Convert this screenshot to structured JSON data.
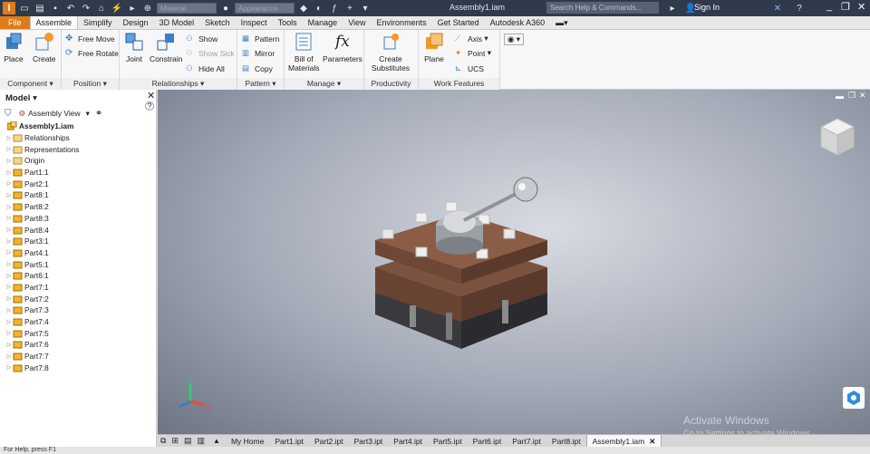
{
  "titlebar": {
    "app_logo": "I",
    "style_dropdown": "Material",
    "appearance_dropdown": "Appearance",
    "document_title": "Assembly1.iam",
    "search_placeholder": "Search Help & Commands...",
    "sign_in": "Sign In"
  },
  "menu": {
    "tabs": [
      "File",
      "Assemble",
      "Simplify",
      "Design",
      "3D Model",
      "Sketch",
      "Inspect",
      "Tools",
      "Manage",
      "View",
      "Environments",
      "Get Started",
      "Autodesk A360"
    ],
    "active": "Assemble"
  },
  "ribbon": {
    "component": {
      "title": "Component",
      "place": "Place",
      "create": "Create"
    },
    "position": {
      "title": "Position",
      "free_move": "Free Move",
      "free_rotate": "Free Rotate"
    },
    "relationships": {
      "title": "Relationships",
      "joint": "Joint",
      "constrain": "Constrain",
      "show": "Show",
      "show_sick": "Show Sick",
      "hide_all": "Hide All"
    },
    "pattern": {
      "title": "Pattern",
      "pattern": "Pattern",
      "mirror": "Mirror",
      "copy": "Copy"
    },
    "manage": {
      "title": "Manage",
      "bill_line1": "Bill of",
      "bill_line2": "Materials",
      "parameters": "Parameters"
    },
    "productivity": {
      "title": "Productivity",
      "create_line1": "Create",
      "create_line2": "Substitutes"
    },
    "work_features": {
      "title": "Work Features",
      "plane": "Plane",
      "axis": "Axis",
      "point": "Point",
      "ucs": "UCS"
    }
  },
  "browser": {
    "title": "Model",
    "view_mode": "Assembly View",
    "root": "Assembly1.iam",
    "items": [
      "Relationships",
      "Representations",
      "Origin",
      "Part1:1",
      "Part2:1",
      "Part8:1",
      "Part8:2",
      "Part8:3",
      "Part8:4",
      "Part3:1",
      "Part4:1",
      "Part5:1",
      "Part6:1",
      "Part7:1",
      "Part7:2",
      "Part7:3",
      "Part7:4",
      "Part7:5",
      "Part7:6",
      "Part7:7",
      "Part7:8"
    ]
  },
  "viewport": {
    "watermark_title": "Activate Windows",
    "watermark_sub": "Go to Settings to activate Windows.",
    "triad_x": "X",
    "triad_y": "Y",
    "triad_z": "Z"
  },
  "doctabs": {
    "items": [
      "My Home",
      "Part1.ipt",
      "Part2.ipt",
      "Part3.ipt",
      "Part4.ipt",
      "Part5.ipt",
      "Part6.ipt",
      "Part7.ipt",
      "Part8.ipt",
      "Assembly1.iam"
    ],
    "active": "Assembly1.iam"
  },
  "statusbar": {
    "text": "For Help, press F1"
  }
}
